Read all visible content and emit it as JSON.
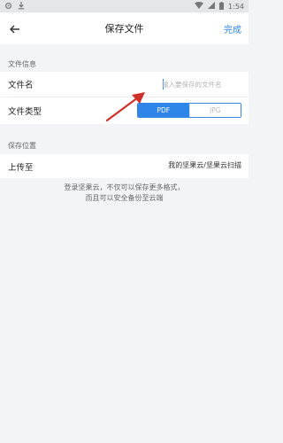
{
  "status_bar": {
    "time": "1:54"
  },
  "nav": {
    "title": "保存文件",
    "done_label": "完成"
  },
  "file_info": {
    "section_label": "文件信息",
    "name_label": "文件名",
    "name_placeholder": "输入要保存的文件名",
    "name_value": "",
    "type_label": "文件类型",
    "type_options": [
      "PDF",
      "JPG"
    ],
    "type_selected": "PDF"
  },
  "save_location": {
    "section_label": "保存位置",
    "upload_label": "上传至",
    "upload_value": "我的坚果云/坚果云扫描"
  },
  "hint": {
    "line1": "登录坚果云，不仅可以保存更多格式，",
    "line2": "而且可以安全备份至云端"
  },
  "colors": {
    "accent": "#2f86e8",
    "annotation_arrow": "#d0302a"
  }
}
